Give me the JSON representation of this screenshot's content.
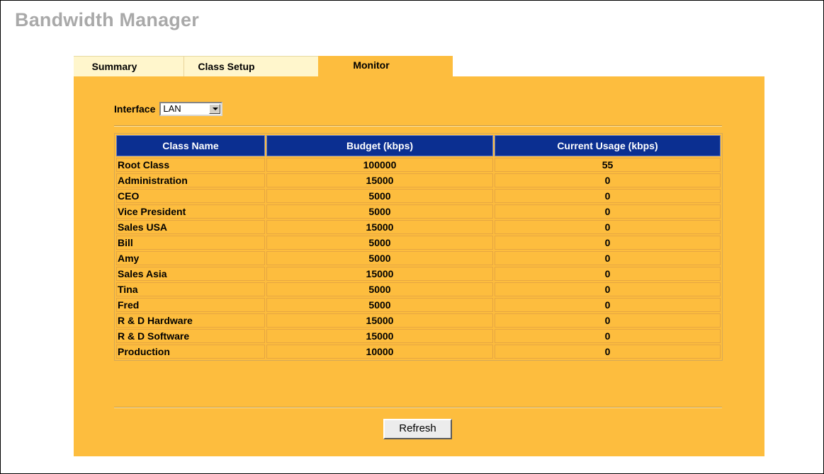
{
  "page_title": "Bandwidth Manager",
  "tabs": [
    {
      "label": "Summary",
      "active": false
    },
    {
      "label": "Class Setup",
      "active": false
    },
    {
      "label": "Monitor",
      "active": true
    }
  ],
  "interface": {
    "label": "Interface",
    "value": "LAN"
  },
  "table": {
    "headers": [
      "Class Name",
      "Budget (kbps)",
      "Current Usage (kbps)"
    ],
    "rows": [
      [
        "Root Class",
        "100000",
        "55"
      ],
      [
        "Administration",
        "15000",
        "0"
      ],
      [
        "CEO",
        "5000",
        "0"
      ],
      [
        "Vice President",
        "5000",
        "0"
      ],
      [
        "Sales USA",
        "15000",
        "0"
      ],
      [
        "Bill",
        "5000",
        "0"
      ],
      [
        "Amy",
        "5000",
        "0"
      ],
      [
        "Sales Asia",
        "15000",
        "0"
      ],
      [
        "Tina",
        "5000",
        "0"
      ],
      [
        "Fred",
        "5000",
        "0"
      ],
      [
        "R & D Hardware",
        "15000",
        "0"
      ],
      [
        "R & D Software",
        "15000",
        "0"
      ],
      [
        "Production",
        "10000",
        "0"
      ]
    ]
  },
  "refresh_label": "Refresh",
  "colors": {
    "panel": "#fdbd3e",
    "inactive_tab": "#fff6cc",
    "header": "#0b2f91",
    "title": "#a9a9a9"
  }
}
